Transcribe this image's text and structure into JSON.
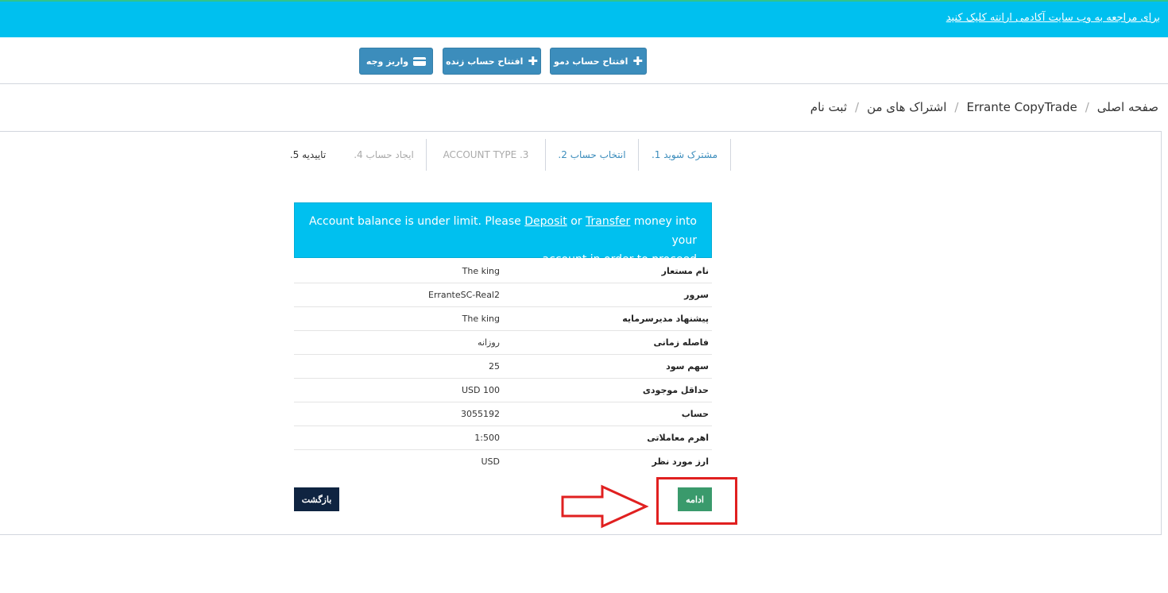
{
  "topbar": {
    "academy_link": "برای مراجعه به وب سایت آکادمی ارانته کلیک کنید",
    "bg_color": "#00c0ef"
  },
  "actions": {
    "deposit_label": "واریز وجه",
    "open_live_label": "افتتاح حساب زنده",
    "open_demo_label": "افتتاح حساب دمو"
  },
  "breadcrumb": {
    "items": [
      "صفحه اصلی",
      "Errante CopyTrade",
      "اشتراک های من",
      "ثبت نام"
    ],
    "separator": "/"
  },
  "steps": [
    {
      "label": "مشترک شوید 1.",
      "state": "active"
    },
    {
      "label": "انتخاب حساب 2.",
      "state": "active"
    },
    {
      "label": "ACCOUNT TYPE .3",
      "state": "muted"
    },
    {
      "label": "ایجاد حساب 4.",
      "state": "muted"
    },
    {
      "label": "تاییدیه 5.",
      "state": "dark"
    }
  ],
  "alert": {
    "text_before": "Account balance is under limit. Please",
    "deposit_link": "Deposit",
    "text_or": "or",
    "transfer_link": "Transfer",
    "text_after": "money into your",
    "line2": ".account in order to proceed"
  },
  "details": [
    {
      "key": "نام مستعار",
      "value": "The king"
    },
    {
      "key": "سرور",
      "value": "ErranteSC-Real2"
    },
    {
      "key": "پیشنهاد مدیرسرمایه",
      "value": "The king"
    },
    {
      "key": "فاصله زمانی",
      "value": "روزانه"
    },
    {
      "key": "سهم سود",
      "value": "25"
    },
    {
      "key": "حداقل موجودی",
      "value": "USD 100"
    },
    {
      "key": "حساب",
      "value": "3055192"
    },
    {
      "key": "اهرم معاملاتی",
      "value": "1:500"
    },
    {
      "key": "ارز مورد نظر",
      "value": "USD"
    }
  ],
  "buttons": {
    "back_label": "بازگشت",
    "continue_label": "ادامه"
  },
  "colors": {
    "primary": "#3c8dbc",
    "info": "#00c0ef",
    "success": "#3a9a6c",
    "dark": "#0f2441",
    "highlight": "#e02020"
  }
}
